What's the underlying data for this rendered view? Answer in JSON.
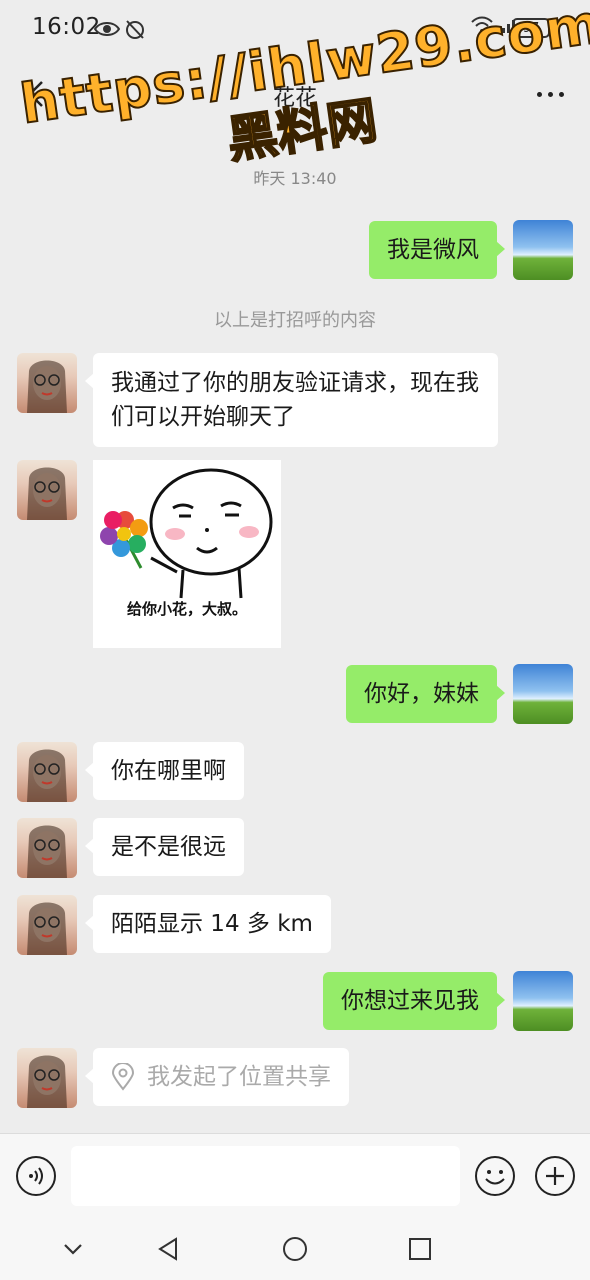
{
  "status_bar": {
    "time": "16:02",
    "battery": "97"
  },
  "header": {
    "title": "花花"
  },
  "watermark": {
    "line1": "https://ihlw29.com",
    "line2": "黑料网"
  },
  "colors": {
    "accent": "#95ec69",
    "background": "#ededed",
    "watermark": "#ffb12b"
  },
  "chat": {
    "timestamp": "昨天 13:40",
    "system_notice": "以上是打招呼的内容",
    "messages": [
      {
        "side": "right",
        "text": "我是微风"
      },
      {
        "side": "left",
        "text": "我通过了你的朋友验证请求，现在我们可以开始聊天了"
      },
      {
        "side": "left",
        "type": "sticker",
        "caption": "给你小花，大叔。"
      },
      {
        "side": "right",
        "text": "你好，妹妹"
      },
      {
        "side": "left",
        "text": "你在哪里啊"
      },
      {
        "side": "left",
        "text": "是不是很远"
      },
      {
        "side": "left",
        "text": "陌陌显示 14 多 km"
      },
      {
        "side": "right",
        "text": "你想过来见我"
      },
      {
        "side": "left",
        "type": "location",
        "text": "我发起了位置共享",
        "icon": "location-pin-icon"
      }
    ]
  },
  "input_bar": {
    "voice_icon": "voice-icon",
    "emoji_icon": "emoji-icon",
    "plus_icon": "plus-icon"
  },
  "nav_bar": {
    "icons": [
      "chevron-down-icon",
      "back-triangle-icon",
      "home-circle-icon",
      "recents-square-icon"
    ]
  }
}
